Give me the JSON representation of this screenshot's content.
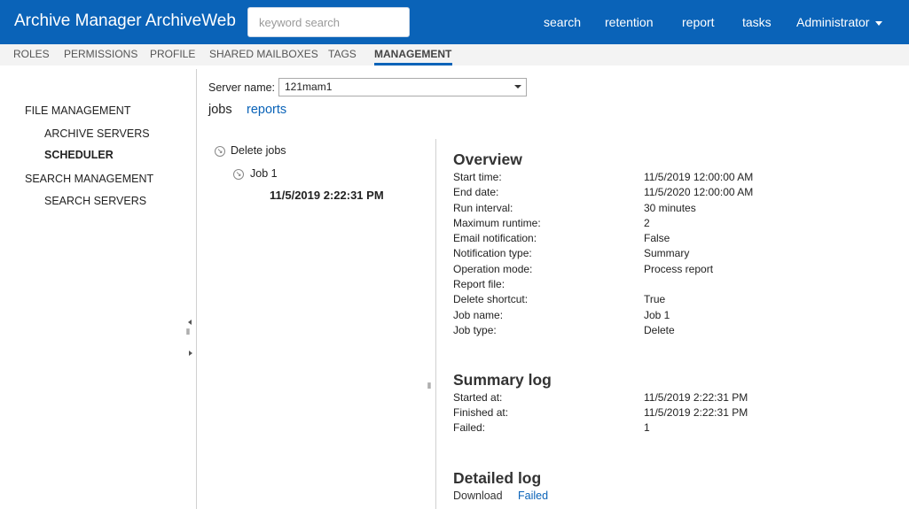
{
  "header": {
    "title": "Archive Manager ArchiveWeb",
    "search_placeholder": "keyword search",
    "nav": [
      "search",
      "retention",
      "report",
      "tasks"
    ],
    "user": "Administrator",
    "bg_color": "#0a63b8"
  },
  "tabs": [
    "ROLES",
    "PERMISSIONS",
    "PROFILE",
    "SHARED MAILBOXES",
    "TAGS",
    "MANAGEMENT"
  ],
  "active_tab": "MANAGEMENT",
  "sidebar": {
    "file_management": "FILE MANAGEMENT",
    "archive_servers": "ARCHIVE SERVERS",
    "scheduler": "SCHEDULER",
    "search_management": "SEARCH MANAGEMENT",
    "search_servers": "SEARCH SERVERS"
  },
  "server": {
    "label": "Server name:",
    "value": "121mam1"
  },
  "views": {
    "jobs": "jobs",
    "reports": "reports"
  },
  "tree": {
    "group": "Delete jobs",
    "job": "Job 1",
    "run": "11/5/2019 2:22:31 PM",
    "icon": "collapse-circle-icon"
  },
  "overview": {
    "title": "Overview",
    "rows": [
      {
        "label": "Start time:",
        "value": "11/5/2019 12:00:00 AM"
      },
      {
        "label": "End date:",
        "value": "11/5/2020 12:00:00 AM"
      },
      {
        "label": "Run interval:",
        "value": "30 minutes"
      },
      {
        "label": "Maximum runtime:",
        "value": "2"
      },
      {
        "label": "Email notification:",
        "value": "False"
      },
      {
        "label": "Notification type:",
        "value": "Summary"
      },
      {
        "label": "Operation mode:",
        "value": "Process report"
      },
      {
        "label": "Report file:",
        "value": ""
      },
      {
        "label": "Delete shortcut:",
        "value": "True"
      },
      {
        "label": "Job name:",
        "value": "Job 1"
      },
      {
        "label": "Job type:",
        "value": "Delete"
      }
    ]
  },
  "summary": {
    "title": "Summary log",
    "rows": [
      {
        "label": "Started at:",
        "value": "11/5/2019 2:22:31 PM"
      },
      {
        "label": "Finished at:",
        "value": "11/5/2019 2:22:31 PM"
      },
      {
        "label": "Failed:",
        "value": "1"
      }
    ]
  },
  "detailed": {
    "title": "Detailed log",
    "download": "Download",
    "failed": "Failed"
  },
  "link_color": "#0a63b8"
}
